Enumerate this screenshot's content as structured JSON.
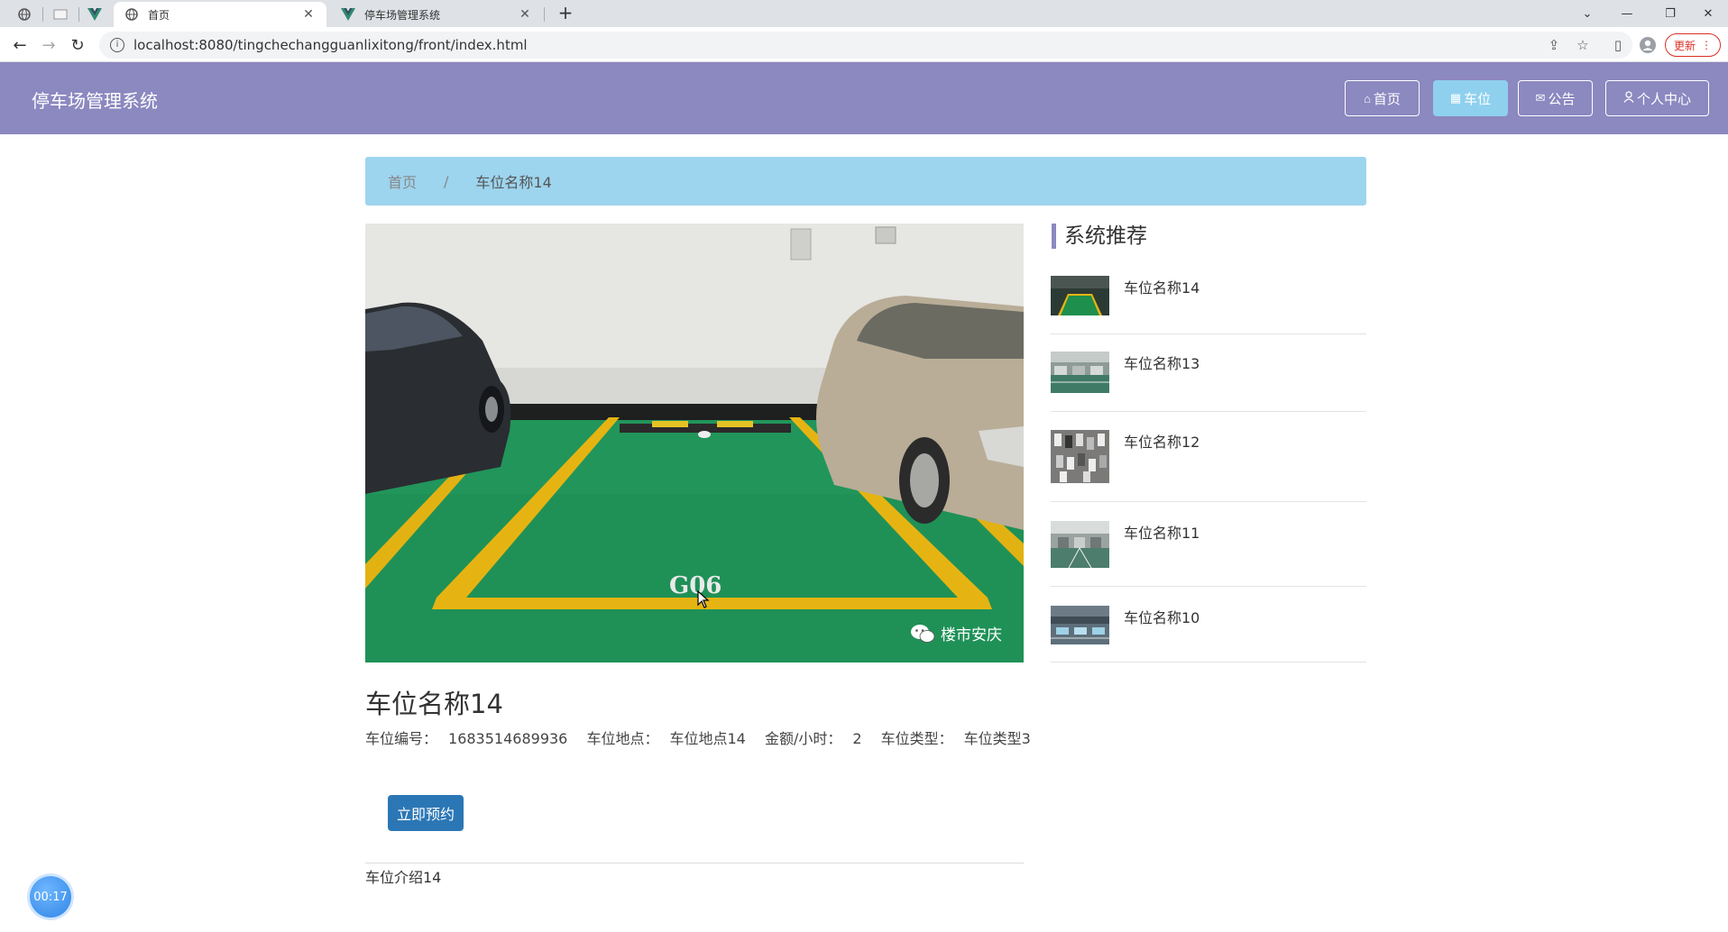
{
  "browser": {
    "tabs": [
      {
        "title": "首页",
        "active": true
      },
      {
        "title": "停车场管理系统",
        "active": false
      }
    ],
    "url": "localhost:8080/tingchechangguanlixitong/front/index.html",
    "update_label": "更新"
  },
  "header": {
    "site_title": "停车场管理系统",
    "nav": [
      {
        "label": "首页",
        "icon": "home-icon",
        "active": false
      },
      {
        "label": "车位",
        "icon": "parking-icon",
        "active": true
      },
      {
        "label": "公告",
        "icon": "mail-icon",
        "active": false
      },
      {
        "label": "个人中心",
        "icon": "user-icon",
        "active": false
      }
    ]
  },
  "breadcrumb": {
    "home": "首页",
    "separator": "/",
    "current": "车位名称14"
  },
  "hero": {
    "spot_code": "G06",
    "watermark": "楼市安庆"
  },
  "detail": {
    "title": "车位名称14",
    "meta": [
      {
        "label": "车位编号：",
        "value": "1683514689936"
      },
      {
        "label": "车位地点：",
        "value": "车位地点14"
      },
      {
        "label": "金额/小时：",
        "value": "2"
      },
      {
        "label": "车位类型：",
        "value": "车位类型3"
      }
    ],
    "reserve_label": "立即预约",
    "intro": "车位介绍14"
  },
  "recommend": {
    "title": "系统推荐",
    "items": [
      {
        "name": "车位名称14"
      },
      {
        "name": "车位名称13"
      },
      {
        "name": "车位名称12"
      },
      {
        "name": "车位名称11"
      },
      {
        "name": "车位名称10"
      }
    ]
  },
  "recorder": {
    "time": "00:17"
  },
  "colors": {
    "header_bg": "#8c88c0",
    "nav_active": "#8fd0ef",
    "breadcrumb_bg": "#9dd4ee",
    "button": "#2b77b5"
  }
}
